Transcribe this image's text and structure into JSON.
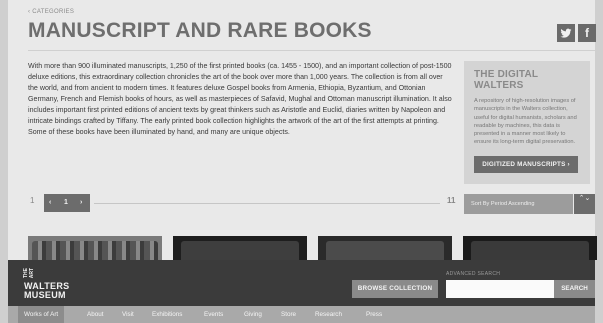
{
  "breadcrumb": "‹ CATEGORIES",
  "page_title": "MANUSCRIPT AND RARE BOOKS",
  "social": {
    "twitter_icon": "twitter-bird-icon",
    "facebook_glyph": "f"
  },
  "intro_text": "With more than 900 illuminated manuscripts, 1,250 of the first printed books (ca. 1455 - 1500), and an important collection of post-1500 deluxe editions, this extraordinary collection chronicles the art of the book over more than 1,000 years. The collection is from all over the world, and from ancient to modern times. It features deluxe Gospel books from Armenia, Ethiopia, Byzantium, and Ottonian Germany, French and Flemish books of hours, as well as masterpieces of Safavid, Mughal and Ottoman manuscript illumination. It also includes important first printed editions of ancient texts by great thinkers such as Aristotle and Euclid, diaries written by Napoleon and intricate bindings crafted by Tiffany. The early printed book collection highlights the artwork of the art of the first attempts at printing. Some of these books have been illuminated by hand, and many are unique objects.",
  "digital_walters": {
    "title": "THE DIGITAL WALTERS",
    "description": "A repository of high-resolution images of manuscripts in the Walters collection, useful for digital humanists, scholars and readable by machines, this data is presented in a manner most likely to ensure its long-term digital preservation.",
    "button_label": "DIGITIZED MANUSCRIPTS ›"
  },
  "pager": {
    "first": "1",
    "prev": "‹",
    "current": "1",
    "next": "›",
    "last": "11"
  },
  "sort": {
    "selected": "Sort By Period Ascending",
    "arrows": "⌃⌄"
  },
  "footer": {
    "logo_the": "THE",
    "logo_art": "ART",
    "logo_walters": "WALTERS",
    "logo_museum": "MUSEUM",
    "browse_label": "BROWSE COLLECTION",
    "advanced_search_label": "ADVANCED SEARCH",
    "search_placeholder": "",
    "search_label": "SEARCH"
  },
  "nav": [
    "Works of Art",
    "About",
    "Visit",
    "Exhibitions",
    "Events",
    "Giving",
    "Store",
    "Research",
    "Press"
  ]
}
